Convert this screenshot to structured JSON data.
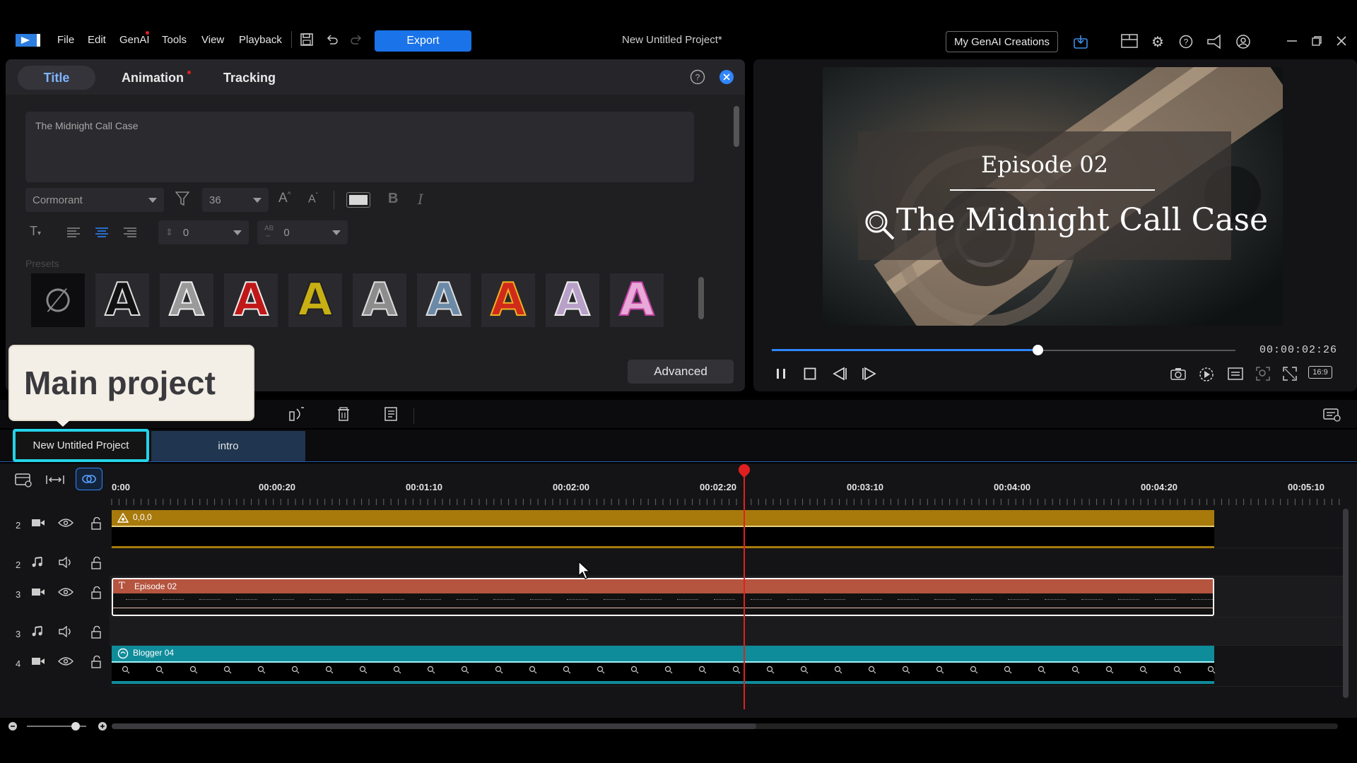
{
  "menu": {
    "items": [
      "File",
      "Edit",
      "GenAI",
      "Tools",
      "View",
      "Playback"
    ],
    "export_label": "Export",
    "project_title": "New Untitled Project*",
    "genai_creations_label": "My GenAI Creations"
  },
  "title_panel": {
    "tabs": [
      "Title",
      "Animation",
      "Tracking"
    ],
    "text_value": "The Midnight Call Case",
    "font_name": "Cormorant",
    "font_size": "36",
    "line_spacing": "0",
    "char_spacing": "0",
    "presets_label": "Presets",
    "preset_glyph": "A",
    "preset_none_glyph": "∅",
    "advanced_label": "Advanced"
  },
  "preview": {
    "episode_text": "Episode 02",
    "title_text": "The Midnight Call Case",
    "timecode": "00:00:02:26",
    "aspect_label": "16:9",
    "progress_fraction": 0.57
  },
  "callout": {
    "text": "Main project"
  },
  "project_tabs": [
    "New Untitled Project",
    "intro"
  ],
  "timeline": {
    "ticks": [
      "0:00",
      "00:00:20",
      "00:01:10",
      "00:02:00",
      "00:02:20",
      "00:03:10",
      "00:04:00",
      "00:04:20",
      "00:05:10"
    ],
    "tracks": [
      {
        "num": "2",
        "type": "video"
      },
      {
        "num": "2",
        "type": "audio"
      },
      {
        "num": "3",
        "type": "video"
      },
      {
        "num": "3",
        "type": "audio"
      },
      {
        "num": "4",
        "type": "video"
      }
    ],
    "clips": [
      {
        "label": "0,0,0",
        "color": "#a87a0c"
      },
      {
        "label": "Episode 02",
        "color": "#b5543f"
      },
      {
        "label": "Blogger 04",
        "color": "#0f8c9a"
      }
    ]
  },
  "colors": {
    "accent": "#1a73e8",
    "highlight": "#24d3e8",
    "playhead": "#e02020"
  }
}
